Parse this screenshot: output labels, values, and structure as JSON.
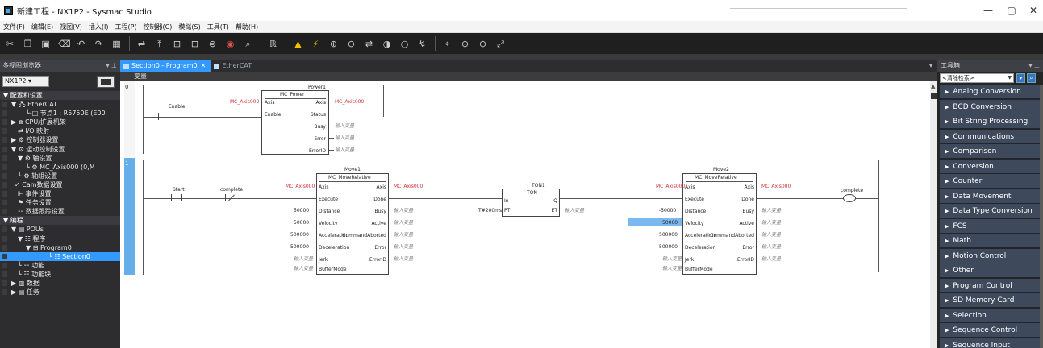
{
  "window": {
    "title": "新建工程 - NX1P2 - Sysmac Studio",
    "minimize": "—",
    "maximize": "▢",
    "close": "✕"
  },
  "menu": [
    "文件(F)",
    "编辑(E)",
    "视图(V)",
    "插入(I)",
    "工程(P)",
    "控制器(C)",
    "模拟(S)",
    "工具(T)",
    "帮助(H)"
  ],
  "toolbar_icons": [
    "cut-icon",
    "copy-icon",
    "paste-icon",
    "delete-icon",
    "undo-icon",
    "redo-icon",
    "build-icon",
    "|",
    "sync-icon",
    "transfer-icon",
    "online-icon",
    "offline-icon",
    "compare-icon",
    "monitor-icon",
    "find-icon",
    "|",
    "program-icon",
    "|",
    "warning-icon",
    "force-icon",
    "set-icon",
    "reset-icon",
    "toggle-icon",
    "on-icon",
    "off-icon",
    "step-icon",
    "|",
    "cross-ref-icon",
    "zoom-in-icon",
    "zoom-out-icon",
    "zoom-fit-icon"
  ],
  "left_panel": {
    "title": "多视图浏览器",
    "pin": "▾ ⊥",
    "device": "NX1P2",
    "tree": [
      {
        "label": "▼ 配置和设置",
        "indent": 4,
        "kind": "section"
      },
      {
        "label": "▼ 🖧 EtherCAT",
        "indent": 14,
        "kind": "item"
      },
      {
        "label": "└-□ 节点1 : R5750E (E00",
        "indent": 32,
        "kind": "item"
      },
      {
        "label": "▶ ⧉ CPU/扩展机架",
        "indent": 14,
        "kind": "item"
      },
      {
        "label": "⇄ I/O 映射",
        "indent": 22,
        "kind": "item"
      },
      {
        "label": "▶ ⚙ 控制器设置",
        "indent": 14,
        "kind": "item"
      },
      {
        "label": "▼ ⚙ 运动控制设置",
        "indent": 14,
        "kind": "item"
      },
      {
        "label": "▼ ⚙ 轴设置",
        "indent": 22,
        "kind": "item"
      },
      {
        "label": "└ ⚙ MC_Axis000 (0,M",
        "indent": 32,
        "kind": "item"
      },
      {
        "label": "└ ⚙ 轴组设置",
        "indent": 22,
        "kind": "item"
      },
      {
        "label": "✓ Cam数据设置",
        "indent": 18,
        "kind": "item"
      },
      {
        "label": "⊩ 事件设置",
        "indent": 22,
        "kind": "item"
      },
      {
        "label": "⚑ 任务设置",
        "indent": 22,
        "kind": "item"
      },
      {
        "label": "☷ 数据跟踪设置",
        "indent": 22,
        "kind": "item"
      },
      {
        "label": "▼ 编程",
        "indent": 4,
        "kind": "section"
      },
      {
        "label": "▼ ▤ POUs",
        "indent": 14,
        "kind": "item"
      },
      {
        "label": "▼ ☷ 程序",
        "indent": 22,
        "kind": "item"
      },
      {
        "label": "▼ ⊟ Program0",
        "indent": 32,
        "kind": "item"
      },
      {
        "label": "└ ☷ Section0",
        "indent": 60,
        "kind": "selected"
      },
      {
        "label": "└ ☷ 功能",
        "indent": 22,
        "kind": "item"
      },
      {
        "label": "└ ☷ 功能块",
        "indent": 22,
        "kind": "item"
      },
      {
        "label": "▶ ▥ 数据",
        "indent": 14,
        "kind": "item"
      },
      {
        "label": "▶ ▤ 任务",
        "indent": 14,
        "kind": "item"
      }
    ]
  },
  "editor": {
    "tabs": [
      {
        "label": "Section0 - Program0",
        "active": true,
        "close": "✕"
      },
      {
        "label": "EtherCAT",
        "active": false
      }
    ],
    "tab_dropdown": "▾",
    "variables_bar": "变量",
    "rungs": [
      {
        "number": "0",
        "contact": "Enable",
        "block": {
          "instance": "Power1",
          "type": "MC_Power",
          "in_axis": "MC_Axis000",
          "pins_left": [
            "Axis",
            "Enable"
          ],
          "pins_right": [
            "Axis",
            "Status",
            "Busy",
            "Error",
            "ErrorID"
          ],
          "out_axis": "MC_Axis000",
          "placeholders": [
            "输入变量",
            "输入变量",
            "输入变量",
            "输入变量"
          ]
        }
      },
      {
        "number": "1",
        "contact_start": "Start",
        "contact_complete": "complete",
        "move1": {
          "instance": "Move1",
          "type": "MC_MoveRelative",
          "in_axis": "MC_Axis000",
          "pins_left": [
            "Axis",
            "Execute",
            "Distance",
            "Velocity",
            "Acceleration",
            "Deceleration",
            "Jerk",
            "BufferMode"
          ],
          "pins_right": [
            "Axis",
            "Done",
            "Busy",
            "Active",
            "CommandAborted",
            "Error",
            "ErrorID"
          ],
          "in_values": [
            "50000",
            "50000",
            "500000",
            "500000",
            "输入变量",
            "输入变量"
          ],
          "out_axis": "MC_Axis000",
          "placeholders": [
            "输入变量",
            "输入变量",
            "输入变量",
            "输入变量",
            "输入变量"
          ]
        },
        "ton": {
          "instance": "TON1",
          "type": "TON",
          "pins_left": [
            "In",
            "PT"
          ],
          "pins_right": [
            "Q",
            "ET"
          ],
          "pt_value": "T#200ms",
          "et_placeholder": "输入变量"
        },
        "move2": {
          "instance": "Move2",
          "type": "MC_MoveRelative",
          "in_axis": "MC_Axis000",
          "pins_left": [
            "Axis",
            "Execute",
            "Distance",
            "Velocity",
            "Acceleration",
            "Deceleration",
            "Jerk",
            "BufferMode"
          ],
          "pins_right": [
            "Axis",
            "Done",
            "Busy",
            "Active",
            "CommandAborted",
            "Error",
            "ErrorID"
          ],
          "in_values": [
            "-50000",
            "50000",
            "500000",
            "500000",
            "输入变量",
            "输入变量"
          ],
          "out_axis": "MC_Axis000",
          "placeholders": [
            "输入变量",
            "输入变量",
            "输入变量",
            "输入变量",
            "输入变量"
          ]
        },
        "coil": "complete"
      }
    ]
  },
  "right_panel": {
    "title": "工具箱",
    "pin": "▾ ⊥",
    "search": "<清除检索>",
    "categories": [
      "Analog Conversion",
      "BCD Conversion",
      "Bit String Processing",
      "Communications",
      "Comparison",
      "Conversion",
      "Counter",
      "Data Movement",
      "Data Type Conversion",
      "FCS",
      "Math",
      "Motion Control",
      "Other",
      "Program Control",
      "SD Memory Card",
      "Selection",
      "Sequence Control",
      "Sequence Input"
    ]
  }
}
